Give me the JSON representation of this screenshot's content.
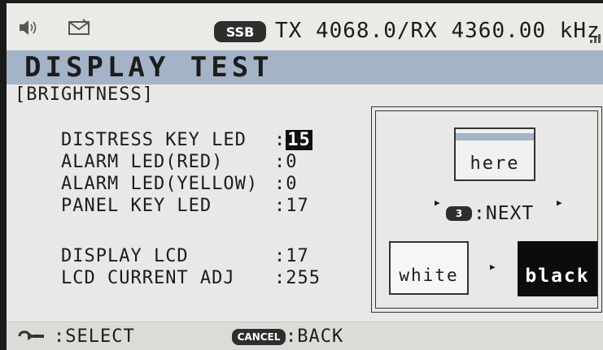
{
  "status": {
    "icons": [
      "speaker-icon",
      "envelope-icon",
      "signal-bars-icon"
    ],
    "mode": "SSB",
    "frequency": "TX 4068.0/RX 4360.00 kHz"
  },
  "title": "DISPLAY TEST",
  "section": "[BRIGHTNESS]",
  "rows": [
    {
      "label": "DISTRESS KEY LED",
      "value": "15",
      "selected": true
    },
    {
      "label": "ALARM LED(RED)",
      "value": "0"
    },
    {
      "label": "ALARM LED(YELLOW)",
      "value": "0"
    },
    {
      "label": "PANEL KEY LED",
      "value": "17"
    },
    {
      "label": "DISPLAY LCD",
      "value": "17"
    },
    {
      "label": "LCD CURRENT ADJ",
      "value": "255"
    }
  ],
  "preview": {
    "here_label": "here",
    "next_key": "3",
    "next_label": ":NEXT",
    "white_label": "white",
    "black_label": "black"
  },
  "footer": {
    "select_label": ":SELECT",
    "cancel_key": "CANCEL",
    "back_label": ":BACK"
  },
  "colors": {
    "title_bar": "#a4b3c7",
    "background": "#e9e8e6",
    "highlight": "#111111"
  }
}
